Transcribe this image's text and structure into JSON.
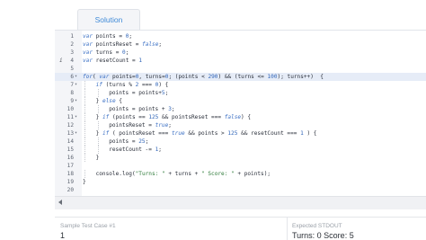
{
  "tab": {
    "label": "Solution"
  },
  "editor": {
    "lines": [
      {
        "num": "1",
        "fold": "",
        "marker": "",
        "active": false,
        "indent": 0,
        "tokens": [
          [
            "kw",
            "var"
          ],
          [
            "t",
            " points = "
          ],
          [
            "num",
            "0"
          ],
          [
            "t",
            ";"
          ]
        ]
      },
      {
        "num": "2",
        "fold": "",
        "marker": "",
        "active": false,
        "indent": 0,
        "tokens": [
          [
            "kw",
            "var"
          ],
          [
            "t",
            " pointsReset = "
          ],
          [
            "kw",
            "false"
          ],
          [
            "t",
            ";"
          ]
        ]
      },
      {
        "num": "3",
        "fold": "",
        "marker": "",
        "active": false,
        "indent": 0,
        "tokens": [
          [
            "kw",
            "var"
          ],
          [
            "t",
            " turns = "
          ],
          [
            "num",
            "0"
          ],
          [
            "t",
            ";"
          ]
        ]
      },
      {
        "num": "4",
        "fold": "",
        "marker": "i",
        "active": false,
        "indent": 0,
        "tokens": [
          [
            "kw",
            "var"
          ],
          [
            "t",
            " resetCount = "
          ],
          [
            "num",
            "1"
          ]
        ]
      },
      {
        "num": "5",
        "fold": "",
        "marker": "",
        "active": false,
        "indent": 0,
        "tokens": []
      },
      {
        "num": "6",
        "fold": "▾",
        "marker": "",
        "active": true,
        "indent": 0,
        "tokens": [
          [
            "kw",
            "for"
          ],
          [
            "t",
            "( "
          ],
          [
            "kw",
            "var"
          ],
          [
            "t",
            " points="
          ],
          [
            "num",
            "0"
          ],
          [
            "t",
            ", turns="
          ],
          [
            "num",
            "0"
          ],
          [
            "t",
            "; (points < "
          ],
          [
            "num",
            "290"
          ],
          [
            "t",
            ") && (turns <= "
          ],
          [
            "num",
            "100"
          ],
          [
            "t",
            "); turns++)  {"
          ]
        ]
      },
      {
        "num": "7",
        "fold": "▾",
        "marker": "",
        "active": false,
        "indent": 1,
        "tokens": [
          [
            "kw",
            "if"
          ],
          [
            "t",
            " (turns % "
          ],
          [
            "num",
            "2"
          ],
          [
            "t",
            " === "
          ],
          [
            "num",
            "0"
          ],
          [
            "t",
            ") {"
          ]
        ]
      },
      {
        "num": "8",
        "fold": "",
        "marker": "",
        "active": false,
        "indent": 2,
        "tokens": [
          [
            "t",
            "points = points+"
          ],
          [
            "num",
            "5"
          ],
          [
            "t",
            ";"
          ]
        ]
      },
      {
        "num": "9",
        "fold": "▾",
        "marker": "",
        "active": false,
        "indent": 1,
        "tokens": [
          [
            "t",
            "} "
          ],
          [
            "kw",
            "else"
          ],
          [
            "t",
            " {"
          ]
        ]
      },
      {
        "num": "10",
        "fold": "",
        "marker": "",
        "active": false,
        "indent": 2,
        "tokens": [
          [
            "t",
            "points = points + "
          ],
          [
            "num",
            "3"
          ],
          [
            "t",
            ";"
          ]
        ]
      },
      {
        "num": "11",
        "fold": "▾",
        "marker": "",
        "active": false,
        "indent": 1,
        "tokens": [
          [
            "t",
            "} "
          ],
          [
            "kw",
            "if"
          ],
          [
            "t",
            " (points == "
          ],
          [
            "num",
            "125"
          ],
          [
            "t",
            " && pointsReset === "
          ],
          [
            "kw",
            "false"
          ],
          [
            "t",
            ") {"
          ]
        ]
      },
      {
        "num": "12",
        "fold": "",
        "marker": "",
        "active": false,
        "indent": 2,
        "tokens": [
          [
            "t",
            "pointsReset = "
          ],
          [
            "kw",
            "true"
          ],
          [
            "t",
            ";"
          ]
        ]
      },
      {
        "num": "13",
        "fold": "▾",
        "marker": "",
        "active": false,
        "indent": 1,
        "tokens": [
          [
            "t",
            "} "
          ],
          [
            "kw",
            "if"
          ],
          [
            "t",
            " ( pointsReset === "
          ],
          [
            "kw",
            "true"
          ],
          [
            "t",
            " && points > "
          ],
          [
            "num",
            "125"
          ],
          [
            "t",
            " && resetCount === "
          ],
          [
            "num",
            "1"
          ],
          [
            "t",
            " ) {"
          ]
        ]
      },
      {
        "num": "14",
        "fold": "",
        "marker": "",
        "active": false,
        "indent": 2,
        "tokens": [
          [
            "t",
            "points = "
          ],
          [
            "num",
            "25"
          ],
          [
            "t",
            ";"
          ]
        ]
      },
      {
        "num": "15",
        "fold": "",
        "marker": "",
        "active": false,
        "indent": 2,
        "tokens": [
          [
            "t",
            "resetCount -= "
          ],
          [
            "num",
            "1"
          ],
          [
            "t",
            ";"
          ]
        ]
      },
      {
        "num": "16",
        "fold": "",
        "marker": "",
        "active": false,
        "indent": 1,
        "tokens": [
          [
            "t",
            "}"
          ]
        ]
      },
      {
        "num": "17",
        "fold": "",
        "marker": "",
        "active": false,
        "indent": 0,
        "tokens": []
      },
      {
        "num": "18",
        "fold": "",
        "marker": "",
        "active": false,
        "indent": 1,
        "tokens": [
          [
            "t",
            "console.log("
          ],
          [
            "str",
            "\"Turns: \""
          ],
          [
            "t",
            " + turns + "
          ],
          [
            "str",
            "\" Score: \""
          ],
          [
            "t",
            " + points);"
          ]
        ]
      },
      {
        "num": "19",
        "fold": "",
        "marker": "",
        "active": false,
        "indent": 0,
        "tokens": [
          [
            "t",
            "}"
          ]
        ]
      },
      {
        "num": "20",
        "fold": "",
        "marker": "",
        "active": false,
        "indent": 0,
        "tokens": []
      }
    ]
  },
  "bottom": {
    "test_case_label": "Sample Test Case #1",
    "test_case_value": "1",
    "expected_label": "Expected STDOUT",
    "expected_value": "Turns: 0 Score: 5"
  }
}
